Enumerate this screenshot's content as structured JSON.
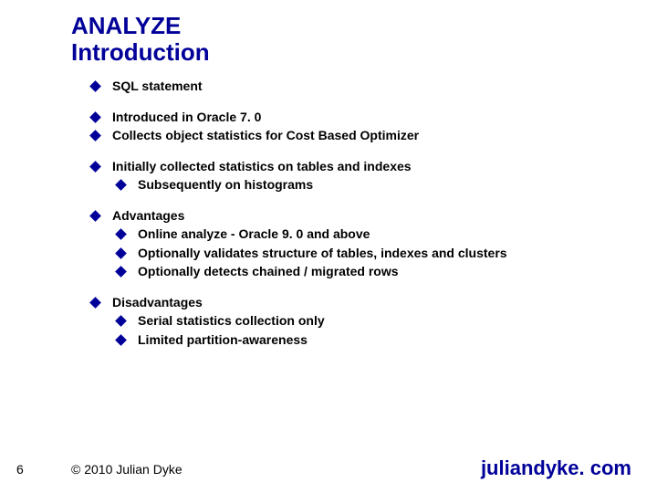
{
  "title": {
    "line1": "ANALYZE",
    "line2": "Introduction"
  },
  "groups": [
    {
      "items": [
        {
          "text": "SQL statement"
        }
      ]
    },
    {
      "items": [
        {
          "text": "Introduced in Oracle 7. 0"
        },
        {
          "text": "Collects object statistics for Cost Based Optimizer"
        }
      ]
    },
    {
      "items": [
        {
          "text": "Initially collected statistics on tables and indexes",
          "sub": [
            {
              "text": "Subsequently on histograms"
            }
          ]
        }
      ]
    },
    {
      "items": [
        {
          "text": "Advantages",
          "sub": [
            {
              "text": "Online analyze - Oracle 9. 0 and above"
            },
            {
              "text": "Optionally validates structure of tables, indexes and clusters"
            },
            {
              "text": "Optionally detects chained / migrated rows"
            }
          ]
        }
      ]
    },
    {
      "items": [
        {
          "text": "Disadvantages",
          "sub": [
            {
              "text": "Serial statistics collection only"
            },
            {
              "text": "Limited partition-awareness"
            }
          ]
        }
      ]
    }
  ],
  "footer": {
    "page": "6",
    "copyright": "© 2010 Julian Dyke",
    "site": "juliandyke. com"
  }
}
